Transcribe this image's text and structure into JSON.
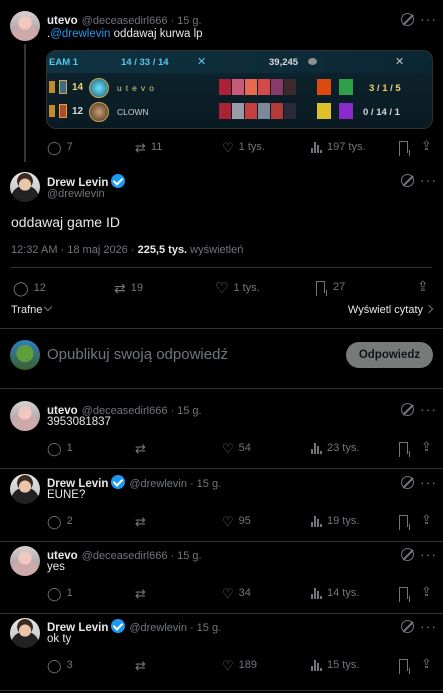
{
  "top_tweet": {
    "name": "utevo",
    "handle": "@deceasedirl666",
    "time": "15 g.",
    "mention": "@drewlevin",
    "text": " oddawaj kurwa lp",
    "card": {
      "team_label": "EAM 1",
      "score": "14 / 33 / 14",
      "gold": "39,245",
      "rows": [
        {
          "level": "14",
          "name": "utevo",
          "kda": "3 / 1 / 5"
        },
        {
          "level": "12",
          "name": "CLOWN",
          "kda": "0 / 14 / 1"
        }
      ]
    },
    "stats": {
      "replies": "7",
      "reposts": "11",
      "likes": "1 tys.",
      "views": "197 tys."
    }
  },
  "main_tweet": {
    "name": "Drew Levin",
    "handle": "@drewlevin",
    "text": "oddawaj game ID",
    "time": "12:32 AM · 18 maj 2026 · ",
    "views_count": "225,5 tys.",
    "views_label": " wyświetleń",
    "stats": {
      "replies": "12",
      "reposts": "19",
      "likes": "1 tys.",
      "bookmarks": "27"
    }
  },
  "sort": {
    "label": "Trafne",
    "quotes_link": "Wyświetl cytaty"
  },
  "composer": {
    "placeholder": "Opublikuj swoją odpowiedź",
    "button": "Odpowiedz"
  },
  "replies": [
    {
      "name": "utevo",
      "handle": "@deceasedirl666",
      "time": "15 g.",
      "text": "3953081837",
      "verified": false,
      "avatar": "girl",
      "stats": {
        "replies": "1",
        "likes": "54",
        "views": "23 tys."
      }
    },
    {
      "name": "Drew Levin",
      "handle": "@drewlevin",
      "time": "15 g.",
      "text": "EUNE?",
      "verified": true,
      "avatar": "man",
      "stats": {
        "replies": "2",
        "likes": "95",
        "views": "19 tys."
      }
    },
    {
      "name": "utevo",
      "handle": "@deceasedirl666",
      "time": "15 g.",
      "text": "yes",
      "verified": false,
      "avatar": "girl",
      "stats": {
        "replies": "1",
        "likes": "34",
        "views": "14 tys."
      }
    },
    {
      "name": "Drew Levin",
      "handle": "@drewlevin",
      "time": "15 g.",
      "text": "ok ty",
      "verified": true,
      "avatar": "man",
      "stats": {
        "replies": "3",
        "likes": "189",
        "views": "15 tys."
      }
    }
  ],
  "colors": {
    "accent": "#1d9bf0",
    "background": "#000000",
    "muted": "#71767b",
    "border": "#2f3336"
  },
  "icons": [
    "grok-icon",
    "more-icon",
    "reply-icon",
    "repost-icon",
    "like-icon",
    "views-icon",
    "bookmark-icon",
    "share-icon",
    "verified-icon",
    "chevron-down-icon",
    "chevron-right-icon"
  ]
}
